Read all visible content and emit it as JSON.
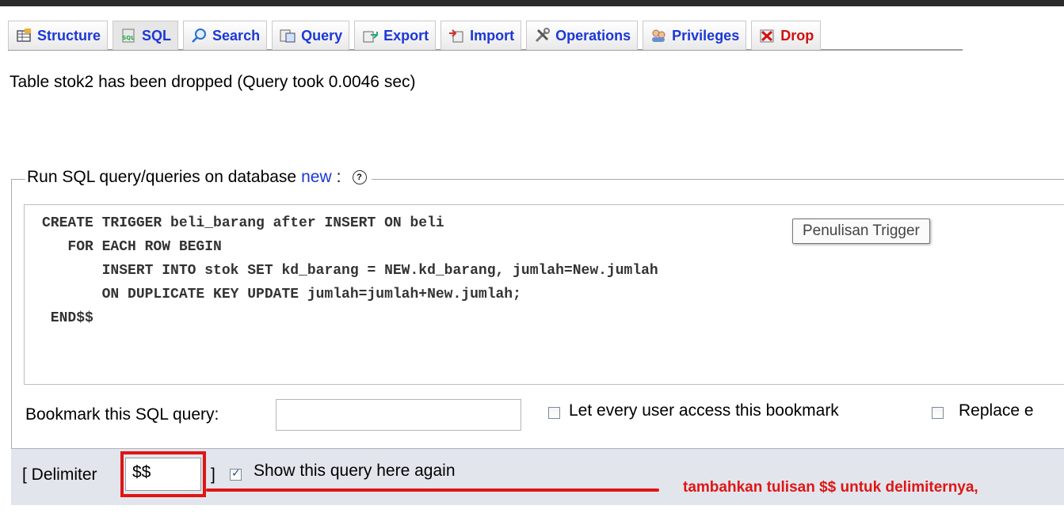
{
  "tabs": [
    {
      "label": "Structure",
      "icon": "structure-icon"
    },
    {
      "label": "SQL",
      "icon": "sql-icon"
    },
    {
      "label": "Search",
      "icon": "search-icon"
    },
    {
      "label": "Query",
      "icon": "query-icon"
    },
    {
      "label": "Export",
      "icon": "export-icon"
    },
    {
      "label": "Import",
      "icon": "import-icon"
    },
    {
      "label": "Operations",
      "icon": "operations-icon"
    },
    {
      "label": "Privileges",
      "icon": "privileges-icon"
    },
    {
      "label": "Drop",
      "icon": "drop-icon"
    }
  ],
  "message": "Table stok2 has been dropped (Query took 0.0046 sec)",
  "sql_panel": {
    "legend_prefix": "Run SQL query/queries on database",
    "database_link": "new",
    "legend_suffix": ":",
    "code_lines": [
      "CREATE TRIGGER beli_barang after INSERT ON beli",
      "   FOR EACH ROW BEGIN",
      "       INSERT INTO stok SET kd_barang = NEW.kd_barang, jumlah=New.jumlah",
      "       ON DUPLICATE KEY UPDATE jumlah=jumlah+New.jumlah;",
      " END$$"
    ],
    "tooltip": "Penulisan Trigger",
    "bookmark_label": "Bookmark this SQL query:",
    "bookmark_value": "",
    "every_user_label": "Let every user access this bookmark",
    "replace_label": "Replace e",
    "delimiter_open": "[ Delimiter",
    "delimiter_value": "$$",
    "delimiter_close": "]",
    "show_query_label": "Show this query here again",
    "show_query_checked": true
  },
  "annotation": "tambahkan tulisan $$ untuk delimiternya,",
  "colors": {
    "link": "#1b38d6",
    "drop": "#d01010",
    "annotation": "#e01515",
    "panel": "#e2e6ec"
  }
}
